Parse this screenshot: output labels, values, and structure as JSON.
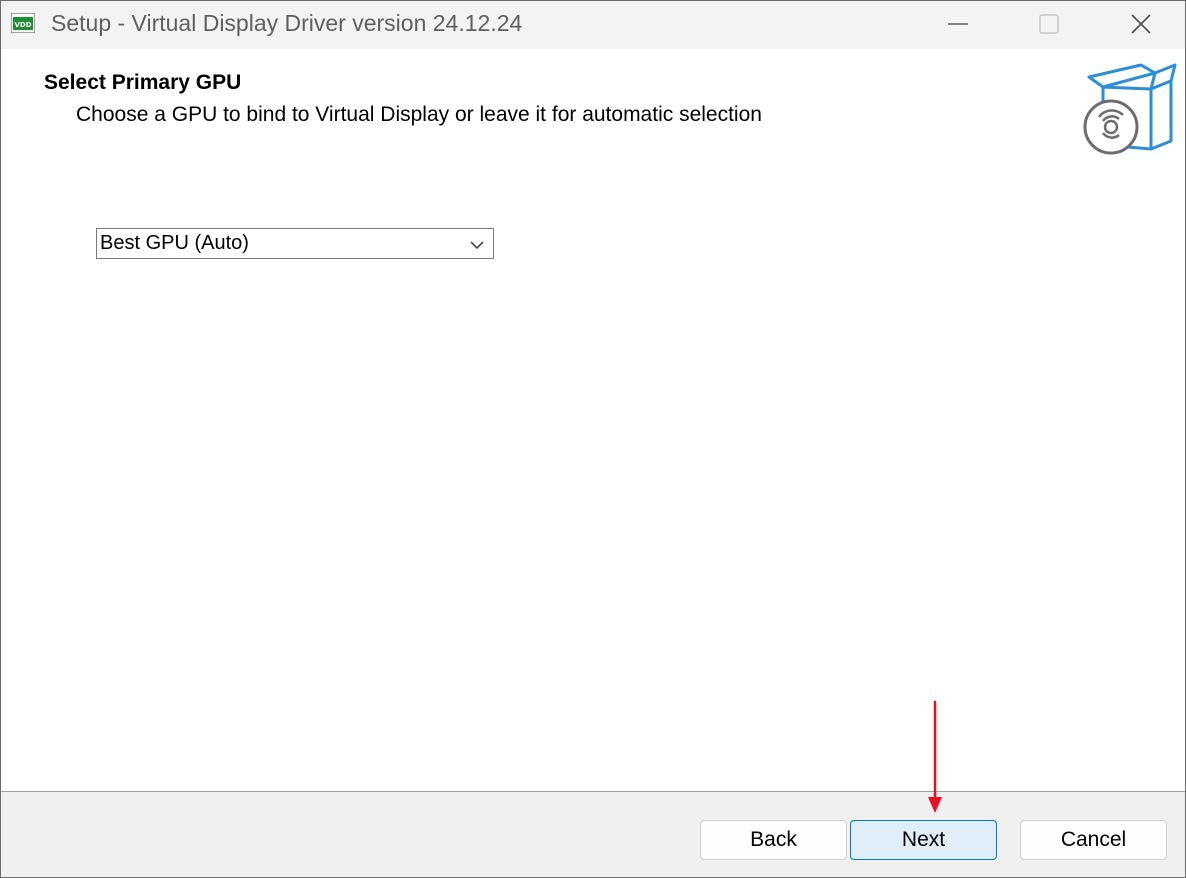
{
  "window": {
    "title": "Setup - Virtual Display Driver version 24.12.24",
    "app_icon_text": "VDD",
    "controls": {
      "minimize_icon": "minimize-icon",
      "maximize_icon": "maximize-icon",
      "close_icon": "close-icon"
    }
  },
  "header": {
    "title": "Select Primary GPU",
    "subtitle": "Choose a GPU to bind to Virtual Display or leave it for automatic selection",
    "image_icon": "software-box-icon"
  },
  "gpu_select": {
    "selected_value": "Best GPU (Auto)",
    "chevron_icon": "chevron-down-icon"
  },
  "buttons": {
    "back_label": "Back",
    "next_label": "Next",
    "cancel_label": "Cancel"
  },
  "annotation": {
    "arrow_icon": "red-arrow-down-icon",
    "arrow_color": "#e81123"
  },
  "colors": {
    "titlebar_bg": "#f3f3f3",
    "bottom_bar_bg": "#f0f0f0",
    "accent": "#0078d4",
    "box_blue": "#2a8fd8",
    "disc_gray": "#6d6d6d"
  }
}
